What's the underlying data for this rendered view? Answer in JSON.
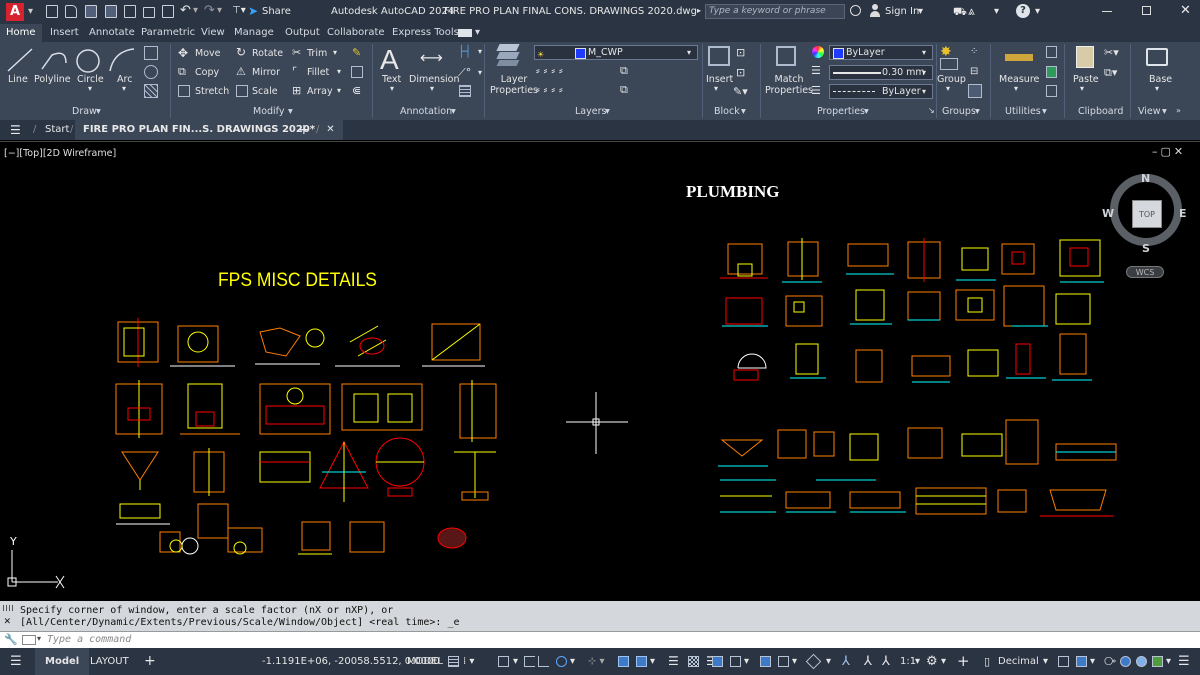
{
  "app": {
    "logo": "A",
    "share_label": "Share",
    "title": "Autodesk AutoCAD 2024",
    "filename": "FIRE PRO PLAN FINAL CONS. DRAWINGS 2020.dwg",
    "search_placeholder": "Type a keyword or phrase",
    "sign_in": "Sign In"
  },
  "ribbon_tabs": [
    "Home",
    "Insert",
    "Annotate",
    "Parametric",
    "View",
    "Manage",
    "Output",
    "Collaborate",
    "Express Tools"
  ],
  "draw": {
    "line": "Line",
    "polyline": "Polyline",
    "circle": "Circle",
    "arc": "Arc",
    "panel": "Draw"
  },
  "modify": {
    "move": "Move",
    "rotate": "Rotate",
    "trim": "Trim",
    "copy": "Copy",
    "mirror": "Mirror",
    "fillet": "Fillet",
    "stretch": "Stretch",
    "scale": "Scale",
    "array": "Array",
    "panel": "Modify"
  },
  "annotation": {
    "text": "Text",
    "dimension": "Dimension",
    "panel": "Annotation"
  },
  "layers": {
    "layer_properties": "Layer\nProperties",
    "current_layer": "M_CWP",
    "panel": "Layers"
  },
  "block": {
    "insert": "Insert",
    "panel": "Block"
  },
  "properties": {
    "match": "Match\nProperties",
    "color": "ByLayer",
    "lineweight": "0.30 mm",
    "linetype": "ByLayer",
    "panel": "Properties"
  },
  "groups": {
    "group": "Group",
    "panel": "Groups"
  },
  "utilities": {
    "measure": "Measure",
    "panel": "Utilities"
  },
  "clipboard": {
    "paste": "Paste",
    "panel": "Clipboard"
  },
  "view_panel": {
    "base": "Base",
    "panel": "View"
  },
  "file_tabs": {
    "start": "Start",
    "active": "FIRE PRO PLAN FIN...S. DRAWINGS 2020*"
  },
  "viewport": {
    "label": "[−][Top][2D Wireframe]",
    "title_left": "FPS MISC DETAILS",
    "title_right": "PLUMBING",
    "viewcube": {
      "n": "N",
      "s": "S",
      "e": "E",
      "w": "W",
      "top": "TOP",
      "wcs": "WCS"
    },
    "ucs_y": "Y"
  },
  "command": {
    "line1": "Specify corner of window, enter a scale factor (nX or nXP), or",
    "line2": "[All/Center/Dynamic/Extents/Previous/Scale/Window/Object] <real time>: _e",
    "placeholder": "Type a command"
  },
  "status": {
    "model_tab": "Model",
    "layout_tab": "LAYOUT",
    "coords": "-1.1191E+06, -20058.5512, 0.0000",
    "space": "MODEL",
    "scale": "1:1",
    "units": "Decimal"
  },
  "colors": {
    "accent": "#d6232f",
    "titlebar": "#2b3443",
    "ribbon": "#3b4657",
    "drawing_yellow": "#ffff00",
    "drawing_orange": "#ff7f00",
    "drawing_cyan": "#00ffff",
    "drawing_red": "#ff0000"
  }
}
